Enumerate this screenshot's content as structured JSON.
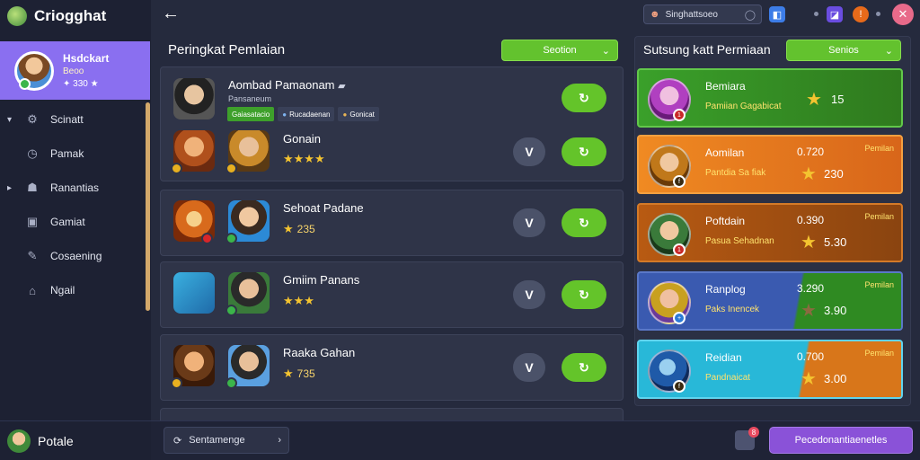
{
  "app": {
    "name": "Criogghat"
  },
  "profile": {
    "name": "Hsdckart",
    "subtitle": "Beoo",
    "stats": "330"
  },
  "sidebar": {
    "items": [
      {
        "label": "Scinatt",
        "icon": "gear-icon",
        "expandable": true
      },
      {
        "label": "Pamak",
        "icon": "clock-icon",
        "expandable": false
      },
      {
        "label": "Ranantias",
        "icon": "group-icon",
        "expandable": true
      },
      {
        "label": "Gamiat",
        "icon": "window-icon",
        "expandable": false
      },
      {
        "label": "Cosaening",
        "icon": "pencil-icon",
        "expandable": false
      },
      {
        "label": "Ngail",
        "icon": "home-icon",
        "expandable": false
      }
    ],
    "footer_label": "Potale"
  },
  "topbar": {
    "search_text": "Singhattsoeo"
  },
  "main": {
    "title": "Peringkat Pemlaian",
    "filter_label": "Seotion",
    "cards": [
      {
        "title": "Aombad Pamaonam",
        "subtitle": "Pansaneum",
        "tags": [
          "Gaiasatacio",
          "Rucadaenan",
          "Gonicat"
        ],
        "row2_title": "Gonain",
        "row2_rating": "★★★★",
        "action": "V"
      },
      {
        "title": "Sehoat Padane",
        "rating": "★",
        "score": "235",
        "action": "V"
      },
      {
        "title": "Gmiim Panans",
        "rating": "★★★",
        "score": "",
        "action": "V"
      },
      {
        "title": "Raaka Gahan",
        "rating": "★",
        "score": "735",
        "action": "V"
      }
    ]
  },
  "side": {
    "title": "Sutsung katt Permiaan",
    "filter_label": "Senios",
    "cards": [
      {
        "title": "Bemiara",
        "subtitle": "Pamiian Gagabicat",
        "score": "",
        "tag": "",
        "value": "15",
        "color": "#2f8a22"
      },
      {
        "title": "Aomilan",
        "subtitle": "Pantdia Sa fiak",
        "score": "0.720",
        "tag": "Pemilan",
        "value": "230",
        "color": "#e8781a"
      },
      {
        "title": "Poftdain",
        "subtitle": "Pasua Sehadnan",
        "score": "0.390",
        "tag": "Pemilan",
        "value": "5.30",
        "color": "#c96a16"
      },
      {
        "title": "Ranplog",
        "subtitle": "Paks Inencek",
        "score": "3.290",
        "tag": "Pemilan",
        "value": "3.90",
        "color": "#4a5fb0"
      },
      {
        "title": "Reidian",
        "subtitle": "Pandnaicat",
        "score": "0.700",
        "tag": "Pemilan",
        "value": "3.00",
        "color": "#1fa7c8"
      }
    ]
  },
  "bottom": {
    "search_text": "Sentamenge",
    "notification_count": "8",
    "cta_label": "Pecedonantiaenetles"
  }
}
